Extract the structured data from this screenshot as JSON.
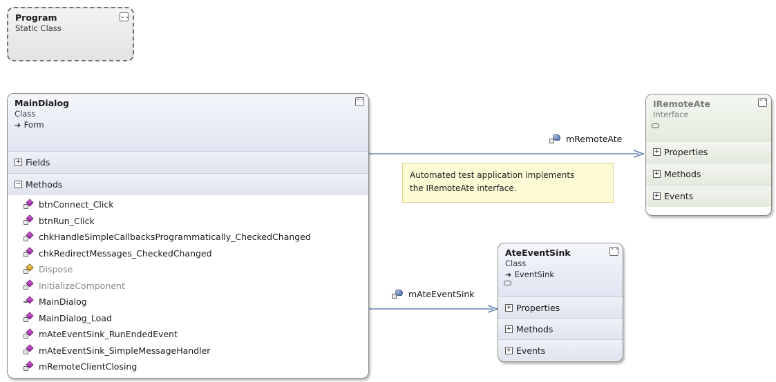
{
  "program": {
    "name": "Program",
    "kind": "Static Class"
  },
  "main_dialog": {
    "name": "MainDialog",
    "kind": "Class",
    "base": "Form",
    "sections": {
      "fields": "Fields",
      "methods": "Methods"
    },
    "methods": [
      {
        "name": "btnConnect_Click",
        "icon": "private-method-icon",
        "muted": false
      },
      {
        "name": "btnRun_Click",
        "icon": "private-method-icon",
        "muted": false
      },
      {
        "name": "chkHandleSimpleCallbacksProgrammatically_CheckedChanged",
        "icon": "private-method-icon",
        "muted": false
      },
      {
        "name": "chkRedirectMessages_CheckedChanged",
        "icon": "private-method-icon",
        "muted": false
      },
      {
        "name": "Dispose",
        "icon": "protected-method-icon",
        "muted": true
      },
      {
        "name": "InitializeComponent",
        "icon": "private-method-icon",
        "muted": true
      },
      {
        "name": "MainDialog",
        "icon": "public-method-icon",
        "muted": false
      },
      {
        "name": "MainDialog_Load",
        "icon": "private-method-icon",
        "muted": false
      },
      {
        "name": "mAteEventSink_RunEndedEvent",
        "icon": "private-method-icon",
        "muted": false
      },
      {
        "name": "mAteEventSink_SimpleMessageHandler",
        "icon": "private-method-icon",
        "muted": false
      },
      {
        "name": "mRemoteClientClosing",
        "icon": "private-method-icon",
        "muted": false
      }
    ]
  },
  "iremote_ate": {
    "name": "IRemoteAte",
    "kind": "Interface",
    "sections": {
      "properties": "Properties",
      "methods": "Methods",
      "events": "Events"
    }
  },
  "ate_event_sink": {
    "name": "AteEventSink",
    "kind": "Class",
    "base": "EventSink",
    "sections": {
      "properties": "Properties",
      "methods": "Methods",
      "events": "Events"
    }
  },
  "associations": {
    "remote_ate": "mRemoteAte",
    "ate_event_sink": "mAteEventSink"
  },
  "note": {
    "line1": "Automated test application implements",
    "line2": "the IRemoteAte interface."
  },
  "glyphs": {
    "expand": "⌄⌄",
    "collapse": "⌃⌃",
    "plus": "+",
    "minus": "−",
    "inherit": "➔"
  },
  "colors": {
    "line": "#4a6aa8",
    "header": "#dfe4f0",
    "note": "#fcfbd6"
  }
}
